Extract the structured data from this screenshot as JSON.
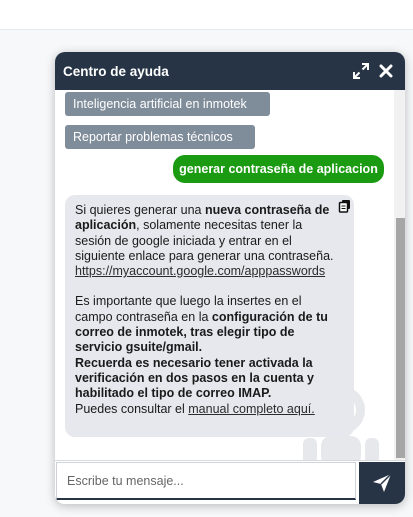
{
  "chat": {
    "title": "Centro de ayuda",
    "quick_replies": [
      "Inteligencia artificial en inmotek",
      "Reportar problemas técnicos"
    ],
    "user_message": "generar contraseña de aplicacion",
    "bot_message": {
      "p1_a": "Si quieres generar una ",
      "p1_b": "nueva contraseña de aplicación",
      "p1_c": ", solamente necesitas tener la sesión de google iniciada y entrar en el siguiente enlace para generar una contraseña.",
      "link": "https://myaccount.google.com/apppasswords",
      "p2_a": "Es importante que luego la insertes en el campo contraseña en la ",
      "p2_b": "configuración de tu correo de inmotek, tras elegir tipo de servicio gsuite/gmail.",
      "p3": "Recuerda es necesario tener activada la verificación en dos pasos en la cuenta y habilitado el tipo de correo IMAP.",
      "p4_a": "Puedes consultar el ",
      "p4_link": "manual completo aquí."
    },
    "input_placeholder": "Escribe tu mensaje..."
  },
  "icons": {
    "expand": "expand-icon",
    "close": "close-icon",
    "copy": "copy-icon",
    "send": "send-icon",
    "watermark": "robot-icon"
  },
  "colors": {
    "header": "#263445",
    "quick_reply": "#7f8c9a",
    "user_bubble": "#1b9b12",
    "bot_bubble": "#e6e8ee"
  }
}
